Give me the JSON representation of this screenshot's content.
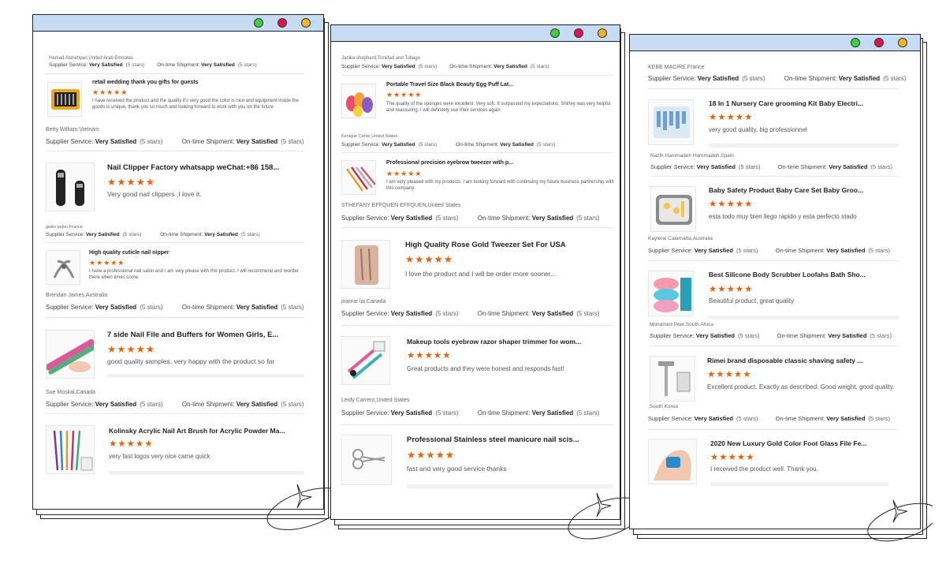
{
  "colors": {
    "titlebar": "#c6dcf5",
    "star": "#e8620d",
    "dot_green": "#3fcf3f",
    "dot_red": "#e0144c",
    "dot_yellow": "#f2b523"
  },
  "labels": {
    "supplier": "Supplier Service:",
    "shipment": "On-time Shipment:",
    "rating": "Very Satisfied",
    "stars_count": "(5 stars)",
    "stars": "★★★★★"
  },
  "windows": [
    {
      "top_meta": "Hamad Alshehyari,United Arab Emirates",
      "reviews": [
        {
          "title": "retail wedding thank you gifts for guests",
          "text": "I have received the product and the quality it's very good the color is nice and equipment inside the goods is unique, thank you so much and looking forward to work with you on the future",
          "author": "Betty William,Vietnam",
          "thumb": "kit-icon"
        },
        {
          "title": "Nail Clipper Factory whatsapp weChat:+86 158...",
          "text": "Very good nail clippers ,I love it.",
          "author": "gwen pejon,France",
          "thumb": "clipper-icon"
        },
        {
          "title": "High quality cuticle nail nipper",
          "text": "I have a professional nail salon and I am very please with this product. I will recommend and reorder there when times come.",
          "author": "Brendan James,Australia",
          "thumb": "nipper-icon"
        },
        {
          "title": "7 side Nail File and Buffers for Women Girls, E...",
          "text": "good quality samples, very happy with the product so far",
          "author": "Sue Moskal,Canada",
          "thumb": "file-icon"
        },
        {
          "title": "Kolinsky Acrylic Nail Art Brush for Acrylic Powder Ma...",
          "text": "very fast logos very nice came quick",
          "author": "",
          "thumb": "brush-icon"
        }
      ]
    },
    {
      "top_meta": "Janika shepherd,Trinidad and Tobago",
      "reviews": [
        {
          "title": "Portable Travel Size Black Beauty Egg Puff Lat...",
          "text": "The quality of the sponges were excellent. Very soft. It surpassed my expectations. Shirley was very helpful and reassuring. I will definitely use their services again",
          "author": "Kenique Carter,United States",
          "thumb": "sponge-icon"
        },
        {
          "title": "Professional precision eyebrow tweezer with p...",
          "text": "I am very pleased with my products. I am looking forward with continuing my future business partnership with this company.",
          "author": "STHEFANY EFFQUEN EFFQUEN,United States",
          "thumb": "tweezer-icon"
        },
        {
          "title": "High Quality Rose Gold Tweezer Set For USA",
          "text": "I love the product and I will be order more sooner...",
          "author": "joanne lai,Canada",
          "thumb": "rosegold-icon"
        },
        {
          "title": "Makeup tools eyebrow razor shaper trimmer for wom...",
          "text": "Great products and they were honest and responds fast!",
          "author": "Leidy Carrero,United States",
          "thumb": "razor-icon"
        },
        {
          "title": "Professional Stainless steel manicure nail scis...",
          "text": "fast and very good service thanks",
          "author": "",
          "thumb": "scissors-icon"
        }
      ]
    },
    {
      "top_meta": "KEBE MACIRE,France",
      "reviews": [
        {
          "title": "18 In 1 Nursery Care grooming Kit Baby Electri...",
          "text": "very good quality, big professionnel",
          "author": "Nazih Hammadeh Hammadeh,Spain",
          "thumb": "nursery-icon"
        },
        {
          "title": "Baby Safety Product Baby Care Set Baby Groo...",
          "text": "esta todo muy bien llego rápido y esta perfecto stado",
          "author": "Kaylene Calamatta,Australia",
          "thumb": "babyset-icon"
        },
        {
          "title": "Best Silicone Body Scrubber Loofahs Bath Sho...",
          "text": "Beautiful product, great quality",
          "author": "Mohamed Peer,South Africa",
          "thumb": "scrubber-icon"
        },
        {
          "title": "Rimei brand disposable classic shaving safety ...",
          "text": "Excellent product. Exactly as described. Good weight, good quality.",
          "author": ",South Korea",
          "thumb": "shaver-icon"
        },
        {
          "title": "2020 New Luxury Gold Color Foot Glass File Fe...",
          "text": "I received the product well. Thank you.",
          "author": "",
          "thumb": "footfile-icon"
        }
      ]
    }
  ]
}
